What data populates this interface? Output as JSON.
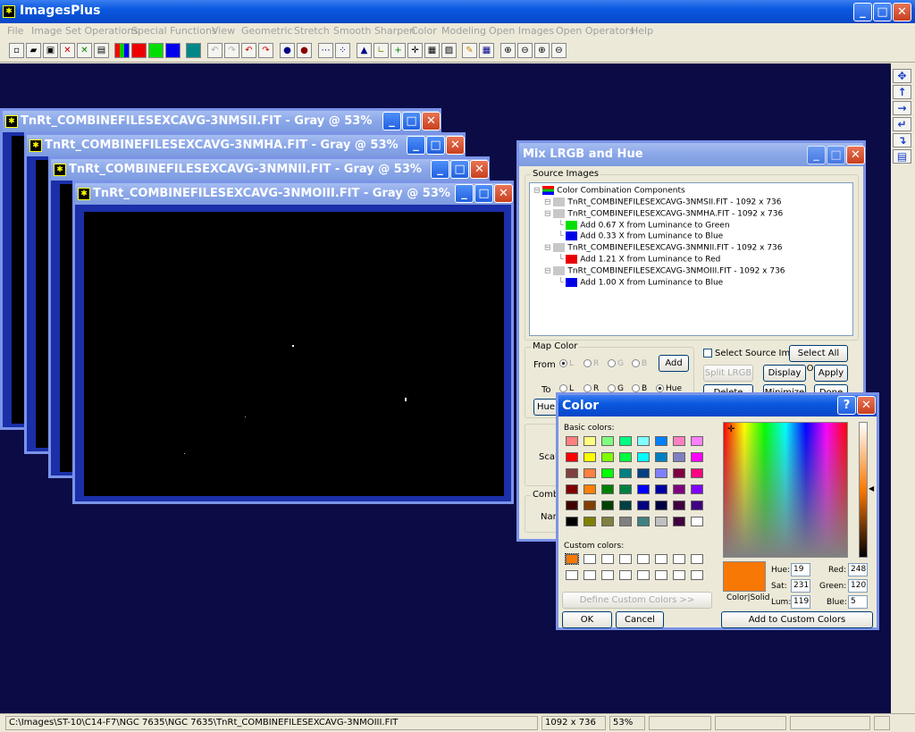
{
  "app": {
    "title": "ImagesPlus"
  },
  "menu": [
    "File",
    "Image Set Operations",
    "Special Functions",
    "View",
    "Geometric",
    "Stretch",
    "Smooth Sharpen",
    "Color",
    "Modeling",
    "Open Images",
    "Open Operators",
    "Help"
  ],
  "image_windows": [
    {
      "title": "TnRt_COMBINEFILESEXCAVG-3NMSII.FIT - Gray @ 53%"
    },
    {
      "title": "TnRt_COMBINEFILESEXCAVG-3NMHA.FIT - Gray @ 53%"
    },
    {
      "title": "TnRt_COMBINEFILESEXCAVG-3NMNII.FIT - Gray @ 53%"
    },
    {
      "title": "TnRt_COMBINEFILESEXCAVG-3NMOIII.FIT - Gray @ 53%"
    }
  ],
  "mix": {
    "title": "Mix LRGB and Hue",
    "source_label": "Source Images",
    "tree_root": "Color Combination Components",
    "tree": [
      {
        "text": "TnRt_COMBINEFILESEXCAVG-3NMSII.FIT - 1092 x 736",
        "color": "#c8c8c8",
        "level": 1
      },
      {
        "text": "TnRt_COMBINEFILESEXCAVG-3NMHA.FIT - 1092 x 736",
        "color": "#c8c8c8",
        "level": 1
      },
      {
        "text": "Add 0.67 X from Luminance to Green",
        "color": "#00e000",
        "level": 2
      },
      {
        "text": "Add 0.33 X from Luminance to Blue",
        "color": "#0000e8",
        "level": 2
      },
      {
        "text": "TnRt_COMBINEFILESEXCAVG-3NMNII.FIT - 1092 x 736",
        "color": "#c8c8c8",
        "level": 1
      },
      {
        "text": "Add 1.21 X from Luminance to Red",
        "color": "#e80000",
        "level": 2
      },
      {
        "text": "TnRt_COMBINEFILESEXCAVG-3NMOIII.FIT - 1092 x 736",
        "color": "#c8c8c8",
        "level": 1
      },
      {
        "text": "Add 1.00 X from Luminance to Blue",
        "color": "#0000e8",
        "level": 2
      }
    ],
    "map_color": "Map Color",
    "from": "From",
    "to": "To",
    "radio_l": "L",
    "radio_r": "R",
    "radio_g": "G",
    "radio_b": "B",
    "radio_hue": "Hue",
    "add": "Add",
    "select_source": "Select Source Image",
    "select_all": "Select All Open",
    "split": "Split LRGB",
    "display": "Display",
    "apply": "Apply",
    "delete": "Delete",
    "minimize": "Minimize",
    "done": "Done",
    "hue_btn": "Hue",
    "scale": "Scale",
    "combine": "Combin",
    "name": "Nam"
  },
  "color_dialog": {
    "title": "Color",
    "help": "?",
    "basic_label": "Basic colors:",
    "custom_label": "Custom colors:",
    "define_btn": "Define Custom Colors >>",
    "ok": "OK",
    "cancel": "Cancel",
    "add_custom": "Add to Custom Colors",
    "color_solid": "Color|Solid",
    "hue_label": "Hue:",
    "hue": "19",
    "sat_label": "Sat:",
    "sat": "231",
    "lum_label": "Lum:",
    "lum": "119",
    "red_label": "Red:",
    "red": "248",
    "green_label": "Green:",
    "green": "120",
    "blue_label": "Blue:",
    "blue": "5",
    "current_color": "#f87805",
    "basic_colors": [
      "#ff8080",
      "#ffff80",
      "#80ff80",
      "#00ff80",
      "#80ffff",
      "#0080ff",
      "#ff80c0",
      "#ff80ff",
      "#ff0000",
      "#ffff00",
      "#80ff00",
      "#00ff40",
      "#00ffff",
      "#0080c0",
      "#8080c0",
      "#ff00ff",
      "#804040",
      "#ff8040",
      "#00ff00",
      "#008080",
      "#004080",
      "#8080ff",
      "#800040",
      "#ff0080",
      "#800000",
      "#ff8000",
      "#008000",
      "#008040",
      "#0000ff",
      "#0000a0",
      "#800080",
      "#8000ff",
      "#400000",
      "#804000",
      "#004000",
      "#004040",
      "#000080",
      "#000040",
      "#400040",
      "#400080",
      "#000000",
      "#808000",
      "#808040",
      "#808080",
      "#408080",
      "#c0c0c0",
      "#400040",
      "#ffffff"
    ]
  },
  "status": {
    "path": "C:\\Images\\ST-10\\C14-F7\\NGC 7635\\NGC 7635\\TnRt_COMBINEFILESEXCAVG-3NMOIII.FIT",
    "dims": "1092 x 736",
    "zoom": "53%"
  }
}
